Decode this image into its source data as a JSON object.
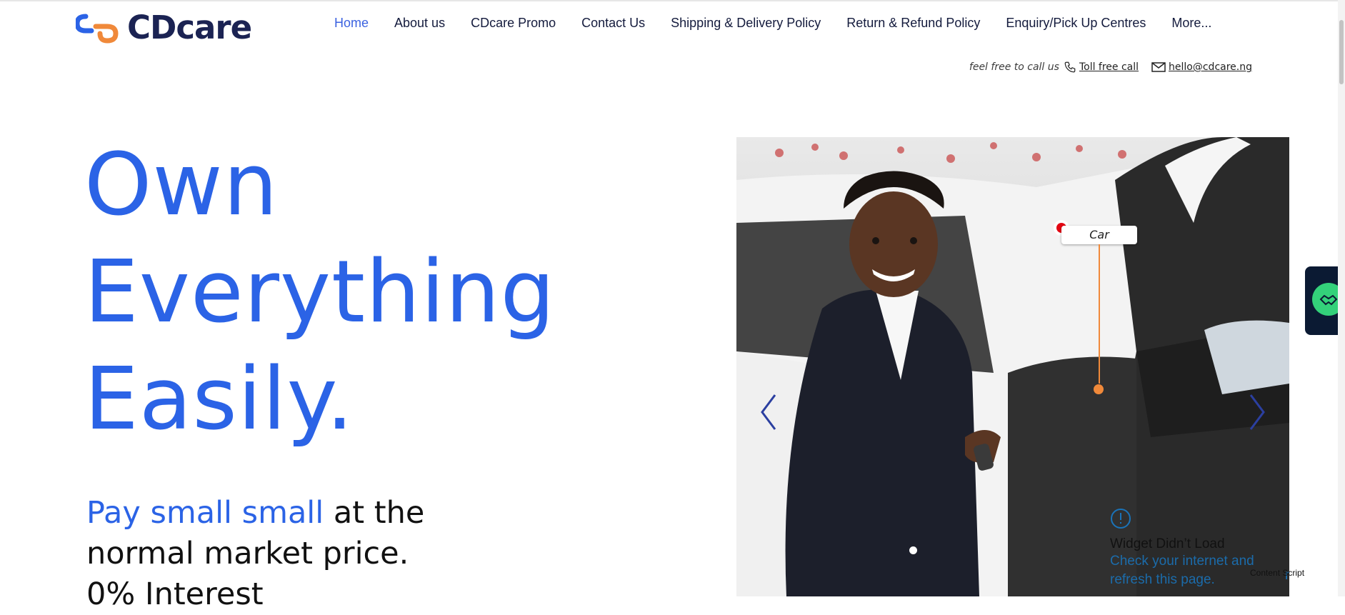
{
  "brand": {
    "name": "CDcare"
  },
  "nav": {
    "items": [
      {
        "label": "Home",
        "active": true
      },
      {
        "label": "About us"
      },
      {
        "label": "CDcare Promo"
      },
      {
        "label": "Contact Us"
      },
      {
        "label": "Shipping & Delivery Policy"
      },
      {
        "label": "Return & Refund Policy"
      },
      {
        "label": "Enquiry/Pick Up Centres"
      },
      {
        "label": "More..."
      }
    ]
  },
  "contact": {
    "prompt": "feel free to call us",
    "phone_label": "Toll free call",
    "email": "hello@cdcare.ng"
  },
  "hero": {
    "title_lines": [
      "Own",
      "Everything",
      "Easily."
    ],
    "sub_accent": "Pay small small",
    "sub_rest": " at the normal market price.",
    "sub_line3": "0% Interest"
  },
  "slider": {
    "hotspot_label": "Car",
    "widget_title": "Widget Didn’t Load",
    "widget_message": "Check your internet and refresh this page.",
    "widget_refresh": "refresh",
    "content_script": "Content Script"
  },
  "icons": {
    "phone": "phone-icon",
    "email": "mail-icon",
    "prev": "chevron-left-icon",
    "next": "chevron-right-icon",
    "alert": "alert-circle-icon",
    "side": "handshake-icon"
  },
  "colors": {
    "brand_blue": "#2b63e6",
    "navy": "#1b2353",
    "orange": "#f0893a",
    "hotspot_red": "#e30613"
  }
}
